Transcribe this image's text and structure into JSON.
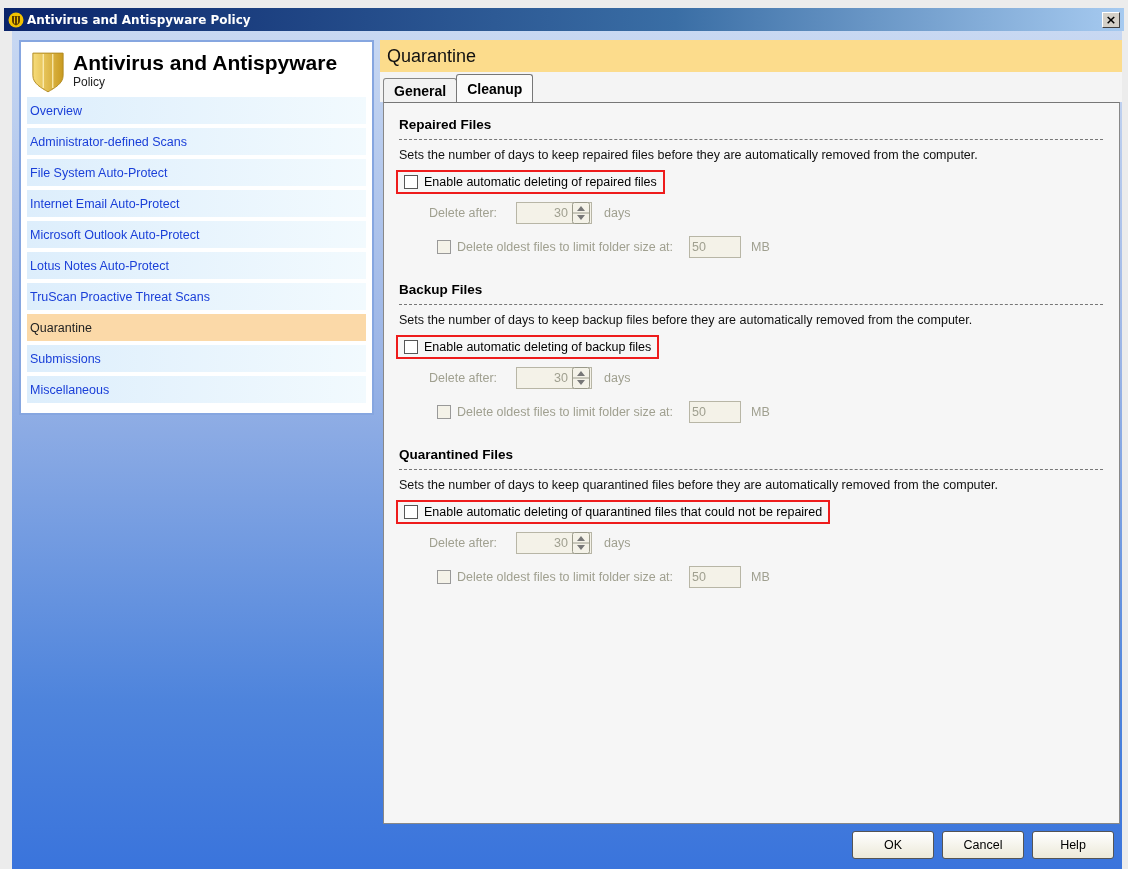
{
  "window": {
    "title": "Antivirus and Antispyware Policy",
    "close": "×"
  },
  "sidebar": {
    "title": "Antivirus and Antispyware",
    "subtitle": "Policy",
    "items": [
      {
        "label": "Overview",
        "selected": false
      },
      {
        "label": "Administrator-defined Scans",
        "selected": false
      },
      {
        "label": "File System Auto-Protect",
        "selected": false
      },
      {
        "label": "Internet Email Auto-Protect",
        "selected": false
      },
      {
        "label": "Microsoft Outlook Auto-Protect",
        "selected": false
      },
      {
        "label": "Lotus Notes Auto-Protect",
        "selected": false
      },
      {
        "label": "TruScan Proactive Threat Scans",
        "selected": false
      },
      {
        "label": "Quarantine",
        "selected": true
      },
      {
        "label": "Submissions",
        "selected": false
      },
      {
        "label": "Miscellaneous",
        "selected": false
      }
    ]
  },
  "panel": {
    "title": "Quarantine",
    "tabs": [
      {
        "label": "General",
        "selected": false
      },
      {
        "label": "Cleanup",
        "selected": true
      }
    ],
    "sections": [
      {
        "heading": "Repaired Files",
        "description": "Sets the number of days to keep repaired files before they are automatically removed from the computer.",
        "enable": {
          "label": "Enable automatic deleting of repaired files",
          "checked": false,
          "highlighted": true
        },
        "delete_after": {
          "label": "Delete after:",
          "value": "30",
          "unit": "days",
          "disabled": true
        },
        "limit": {
          "label": "Delete oldest files to limit folder size at:",
          "checked": false,
          "disabled": true,
          "value": "50",
          "unit": "MB"
        }
      },
      {
        "heading": "Backup Files",
        "description": "Sets the number of days to keep backup files before they are automatically removed from the computer.",
        "enable": {
          "label": "Enable automatic deleting of backup files",
          "checked": false,
          "highlighted": true
        },
        "delete_after": {
          "label": "Delete after:",
          "value": "30",
          "unit": "days",
          "disabled": true
        },
        "limit": {
          "label": "Delete oldest files to limit folder size at:",
          "checked": false,
          "disabled": true,
          "value": "50",
          "unit": "MB"
        }
      },
      {
        "heading": "Quarantined Files",
        "description": "Sets the number of days to keep quarantined files before they are automatically removed from the computer.",
        "enable": {
          "label": "Enable automatic deleting of quarantined files that could not be repaired",
          "checked": false,
          "highlighted": true
        },
        "delete_after": {
          "label": "Delete after:",
          "value": "30",
          "unit": "days",
          "disabled": true
        },
        "limit": {
          "label": "Delete oldest files to limit folder size at:",
          "checked": false,
          "disabled": true,
          "value": "50",
          "unit": "MB"
        }
      }
    ]
  },
  "buttons": [
    "OK",
    "Cancel",
    "Help"
  ]
}
